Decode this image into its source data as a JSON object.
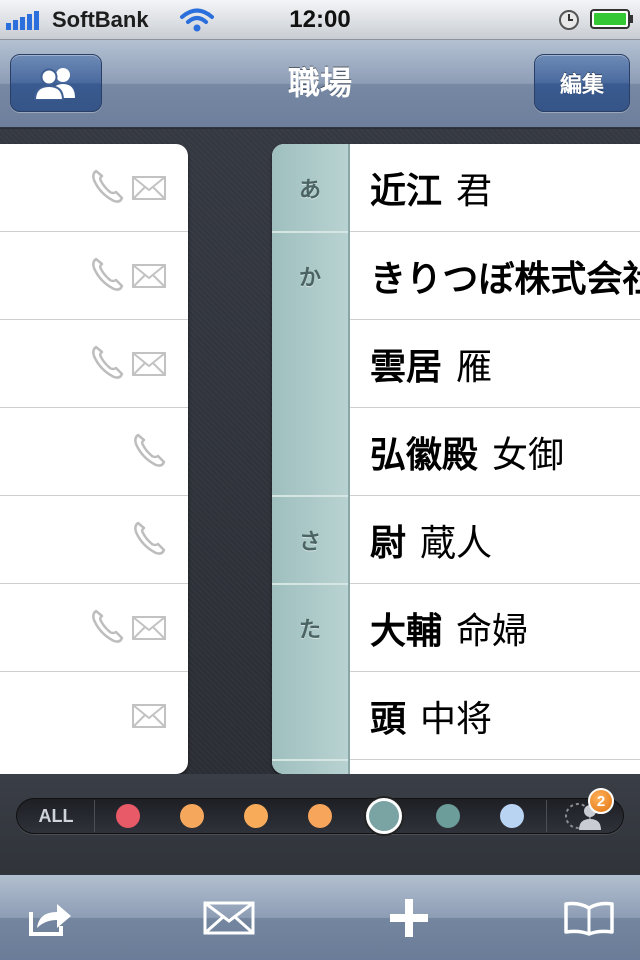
{
  "status_bar": {
    "carrier": "SoftBank",
    "time": "12:00"
  },
  "nav": {
    "title": "職場",
    "edit_label": "編集",
    "left_icon": "groups-icon"
  },
  "index": [
    {
      "label": "あ"
    },
    {
      "label": "か"
    },
    {
      "label": ""
    },
    {
      "label": ""
    },
    {
      "label": "さ"
    },
    {
      "label": "た"
    },
    {
      "label": ""
    }
  ],
  "contacts": [
    {
      "family": "近江",
      "given": "君",
      "phone": true,
      "mail": true
    },
    {
      "family": "きりつぼ株式会社",
      "given": "",
      "phone": true,
      "mail": true
    },
    {
      "family": "雲居",
      "given": "雁",
      "phone": true,
      "mail": true
    },
    {
      "family": "弘徽殿",
      "given": "女御",
      "phone": true,
      "mail": false
    },
    {
      "family": "尉",
      "given": "蔵人",
      "phone": true,
      "mail": false
    },
    {
      "family": "大輔",
      "given": "命婦",
      "phone": true,
      "mail": true
    },
    {
      "family": "頭",
      "given": "中将",
      "phone": false,
      "mail": true
    }
  ],
  "filter": {
    "all_label": "ALL",
    "colors": [
      "#e85a68",
      "#f5a75c",
      "#f8ac5a",
      "#f6a55a",
      "#7aa3a3",
      "#6c9d9a",
      "#b9d3f2"
    ],
    "selected_index": 4,
    "badge_count": "2"
  },
  "toolbar": {
    "icons": [
      "share-icon",
      "mail-icon",
      "add-icon",
      "bookmarks-icon"
    ]
  }
}
